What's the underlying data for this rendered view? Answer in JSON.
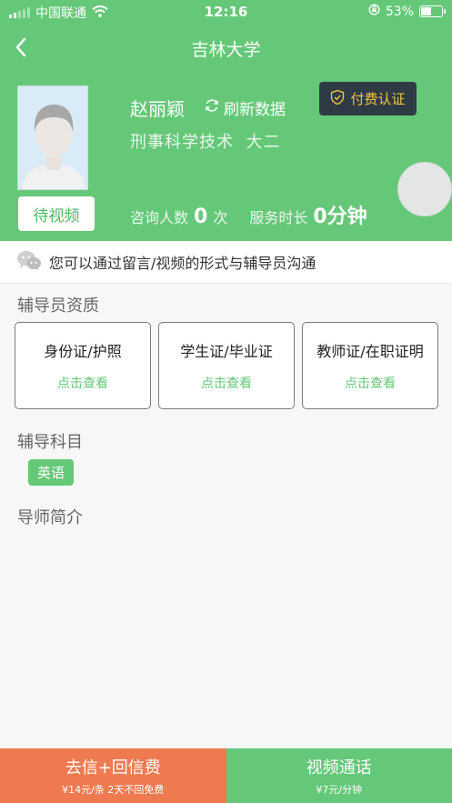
{
  "status_bar": {
    "carrier": "中国联通",
    "time": "12:16",
    "battery_percent": "53%",
    "battery_level": 0.53
  },
  "nav": {
    "title": "吉林大学"
  },
  "profile": {
    "name": "赵丽颖",
    "refresh_label": "刷新数据",
    "major": "刑事科学技术",
    "grade": "大二",
    "wait_video_label": "待视频",
    "pay_verify_label": "付费认证",
    "consult_label": "咨询人数",
    "consult_count": "0",
    "consult_unit": "次",
    "service_label": "服务时长",
    "service_value": "0分钟"
  },
  "notice": {
    "text": "您可以通过留言/视频的形式与辅导员沟通"
  },
  "qualification": {
    "title": "辅导员资质",
    "cards": [
      {
        "title": "身份证/护照",
        "action": "点击查看"
      },
      {
        "title": "学生证/毕业证",
        "action": "点击查看"
      },
      {
        "title": "教师证/在职证明",
        "action": "点击查看"
      }
    ]
  },
  "subjects": {
    "title": "辅导科目",
    "items": [
      "英语"
    ]
  },
  "intro": {
    "title": "导师简介"
  },
  "bottom_bar": {
    "letter": {
      "title": "去信+回信费",
      "sub": "¥14元/条  2天不回免费"
    },
    "video": {
      "title": "视频通话",
      "sub": "¥7元/分钟"
    }
  },
  "colors": {
    "accent": "#65c878",
    "orange": "#ef7a4f",
    "dark": "#2f3b44",
    "gold": "#f4c542"
  }
}
